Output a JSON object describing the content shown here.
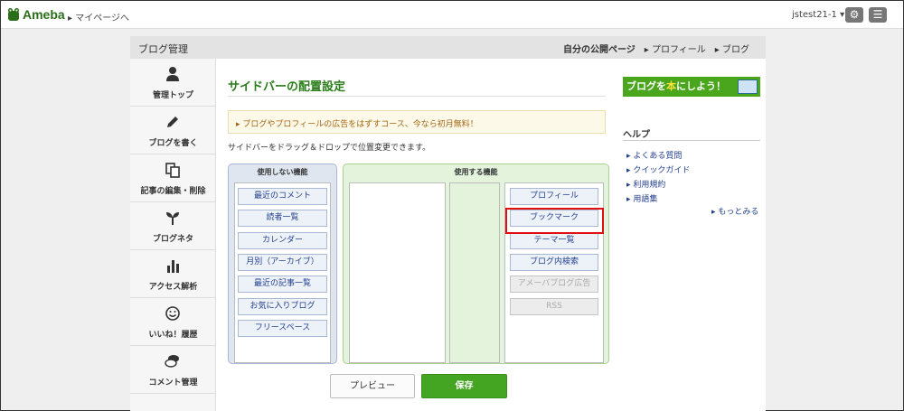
{
  "topbar": {
    "logo": "Ameba",
    "mypage": "▸ マイページへ",
    "user": "jstest21-1 ▾",
    "settings_icon": "gear-icon",
    "menu_icon": "menu-icon"
  },
  "header": {
    "title": "ブログ管理",
    "links": [
      "自分の公開ページ",
      "▸ プロフィール",
      "▸ ブログ"
    ]
  },
  "sidebar": {
    "items": [
      {
        "label": "管理トップ",
        "icon": "person-icon"
      },
      {
        "label": "ブログを書く",
        "icon": "pencil-icon"
      },
      {
        "label": "記事の編集・削除",
        "icon": "copy-icon"
      },
      {
        "label": "ブログネタ",
        "icon": "sprout-icon"
      },
      {
        "label": "アクセス解析",
        "icon": "bar-chart-icon"
      },
      {
        "label": "いいね！履歴",
        "icon": "smile-icon"
      },
      {
        "label": "コメント管理",
        "icon": "comment-icon"
      }
    ]
  },
  "main": {
    "title": "サイドバーの配置設定",
    "notice": "▸ ブログやプロフィールの広告をはずすコース、今なら初月無料！",
    "description": "サイドバーをドラッグ＆ドロップで位置変更できます。",
    "unused": {
      "header": "使用しない機能",
      "modules": [
        "最近のコメント",
        "読者一覧",
        "カレンダー",
        "月別（アーカイブ）",
        "最近の記事一覧",
        "お気に入りブログ",
        "フリースペース"
      ]
    },
    "used": {
      "header": "使用する機能",
      "modules": [
        "プロフィール",
        "ブックマーク",
        "テーマ一覧",
        "ブログ内検索",
        "アメーバブログ広告",
        "RSS"
      ]
    },
    "preview_button": "プレビュー",
    "save_button": "保存"
  },
  "right": {
    "banner_pre": "ブログを",
    "banner_hon": "本",
    "banner_post": "にしよう！",
    "help_title": "ヘルプ",
    "help_links": [
      "▸ よくある質問",
      "▸ クイックガイド",
      "▸ 利用規約",
      "▸ 用語集"
    ],
    "more": "もっとみる"
  },
  "colors": {
    "accent_green": "#43a521",
    "title_green": "#2a7d1a",
    "link_blue": "#24408f",
    "highlight_red": "#e01010"
  }
}
